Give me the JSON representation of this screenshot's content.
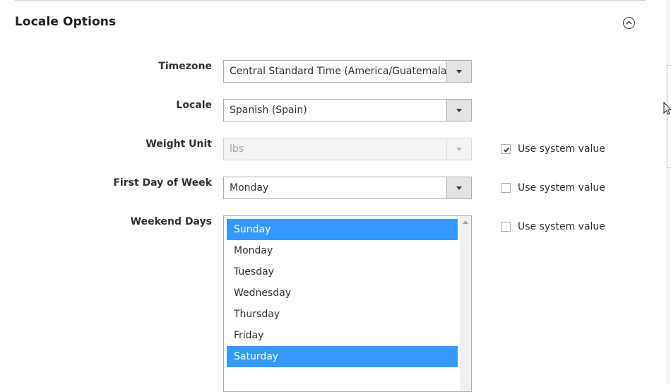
{
  "section": {
    "title": "Locale Options",
    "collapse_icon": "chevron-up-circle-icon"
  },
  "fields": {
    "timezone": {
      "label": "Timezone",
      "value": "Central Standard Time (America/Guatemala)"
    },
    "locale": {
      "label": "Locale",
      "value": "Spanish (Spain)"
    },
    "weight_unit": {
      "label": "Weight Unit",
      "value": "lbs",
      "disabled": true,
      "use_system_value": true
    },
    "first_day": {
      "label": "First Day of Week",
      "value": "Monday",
      "use_system_value": false
    },
    "weekend_days": {
      "label": "Weekend Days",
      "use_system_value": false,
      "options": [
        {
          "label": "Sunday",
          "selected": true
        },
        {
          "label": "Monday",
          "selected": false
        },
        {
          "label": "Tuesday",
          "selected": false
        },
        {
          "label": "Wednesday",
          "selected": false
        },
        {
          "label": "Thursday",
          "selected": false
        },
        {
          "label": "Friday",
          "selected": false
        },
        {
          "label": "Saturday",
          "selected": true
        }
      ]
    }
  },
  "use_system_value_label": "Use system value",
  "colors": {
    "selected_option": "#3399ff",
    "text": "#303030"
  }
}
